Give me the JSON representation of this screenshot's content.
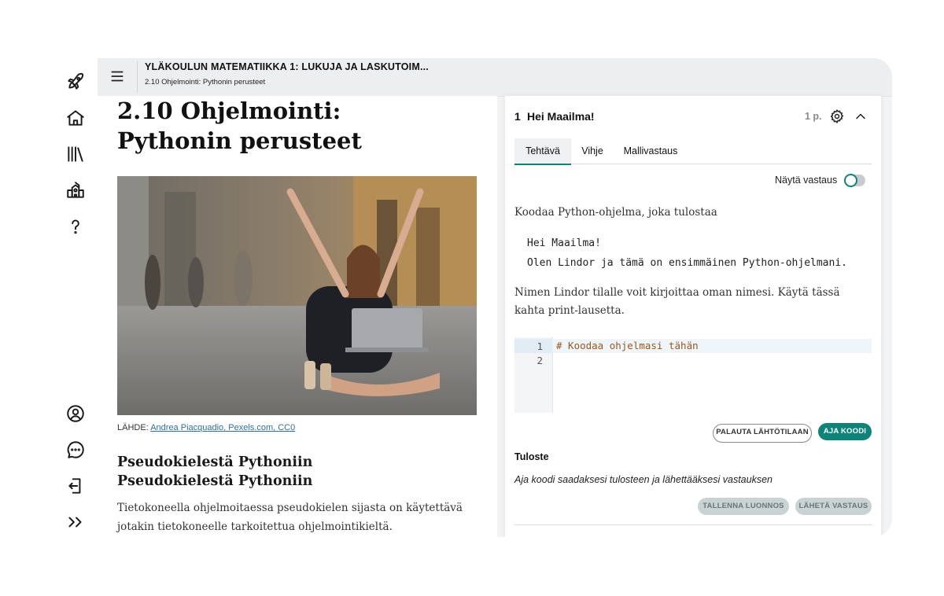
{
  "header": {
    "course_title": "YLÄKOULUN MATEMATIIKKA 1: LUKUJA JA LASKUTOIM...",
    "breadcrumb": "2.10 Ohjelmointi: Pythonin perusteet"
  },
  "sidebar": {
    "icons": [
      "rocket-icon",
      "home-icon",
      "library-icon",
      "school-icon",
      "help-icon",
      "account-icon",
      "chat-icon",
      "logout-icon",
      "expand-icon"
    ]
  },
  "article": {
    "title": "2.10 Ohjelmointi: Pythonin perusteet",
    "image_caption_prefix": "LÄHDE:",
    "image_caption_link": "Andrea Piacquadio, Pexels.com, CC0",
    "subheading_1": "Pseudokielestä Pythoniin",
    "subheading_2": "Pseudokielestä Pythoniin",
    "paragraph": "Tietokoneella ohjelmoitaessa pseudokielen sijasta on käytettävä jotakin tietokoneelle tarkoitettua ohjelmointikieltä. Vaihtoehtoisia kieliä on"
  },
  "task": {
    "number": "1",
    "title": "Hei Maailma!",
    "points": "1 p.",
    "tabs": [
      {
        "label": "Tehtävä",
        "active": true
      },
      {
        "label": "Vihje",
        "active": false
      },
      {
        "label": "Mallivastaus",
        "active": false
      }
    ],
    "show_answer_label": "Näytä vastaus",
    "show_answer_on": false,
    "prompt": "Koodaa Python-ohjelma, joka tulostaa",
    "expected_lines": [
      "Hei Maailma!",
      "Olen Lindor ja tämä on ensimmäinen Python-ohjelmani."
    ],
    "instructions": "Nimen Lindor tilalle voit kirjoittaa oman nimesi. Käytä tässä kahta print-lausetta.",
    "editor": {
      "line_numbers": [
        "1",
        "2"
      ],
      "code": "# Koodaa ohjelmasi tähän"
    },
    "buttons": {
      "reset": "PALAUTA LÄHTÖTILAAN",
      "run": "AJA KOODI",
      "save_draft": "TALLENNA LUONNOS",
      "submit": "LÄHETÄ VASTAUS"
    },
    "output_label": "Tuloste",
    "output_placeholder": "Aja koodi saadaksesi tulosteen ja lähettääksesi vastauksen"
  },
  "colors": {
    "accent": "#0d8478",
    "code_comment": "#a25414",
    "link": "#2a6fb8"
  }
}
